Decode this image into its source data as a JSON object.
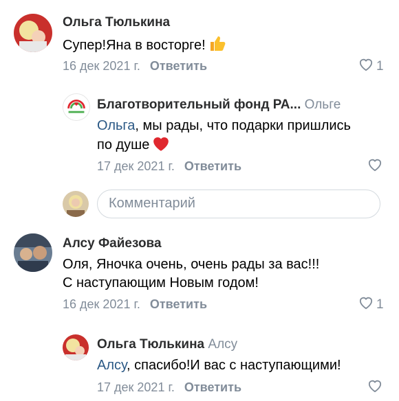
{
  "comments": [
    {
      "author": "Ольга Тюлькина",
      "text": "Супер!Яна в восторге!",
      "date": "16 дек 2021 г.",
      "reply_label": "Ответить",
      "likes": "1"
    },
    {
      "author": "Благотворительный фонд РА...",
      "reply_to": "Ольге",
      "mention": "Ольга",
      "text_line1": ", мы рады, что подарки пришлись",
      "text_line2": "по душе",
      "date": "17 дек 2021 г.",
      "reply_label": "Ответить"
    },
    {
      "author": "Алсу Файезова",
      "text_line1": "Оля, Яночка очень, очень рады за вас!!!",
      "text_line2": "С наступающим Новым годом!",
      "date": "16 дек 2021 г.",
      "reply_label": "Ответить",
      "likes": "1"
    },
    {
      "author": "Ольга Тюлькина",
      "reply_to": "Алсу",
      "mention": "Алсу",
      "text": ", спасибо!И вас с наступающими!",
      "date": "17 дек 2021 г.",
      "reply_label": "Ответить"
    }
  ],
  "comment_input": {
    "placeholder": "Комментарий"
  },
  "colors": {
    "link": "#2a5885",
    "secondary": "#818c99",
    "heart": "#e0282f"
  },
  "icons": [
    "thumbs-up-icon",
    "heart-emoji-icon",
    "like-heart-icon"
  ]
}
